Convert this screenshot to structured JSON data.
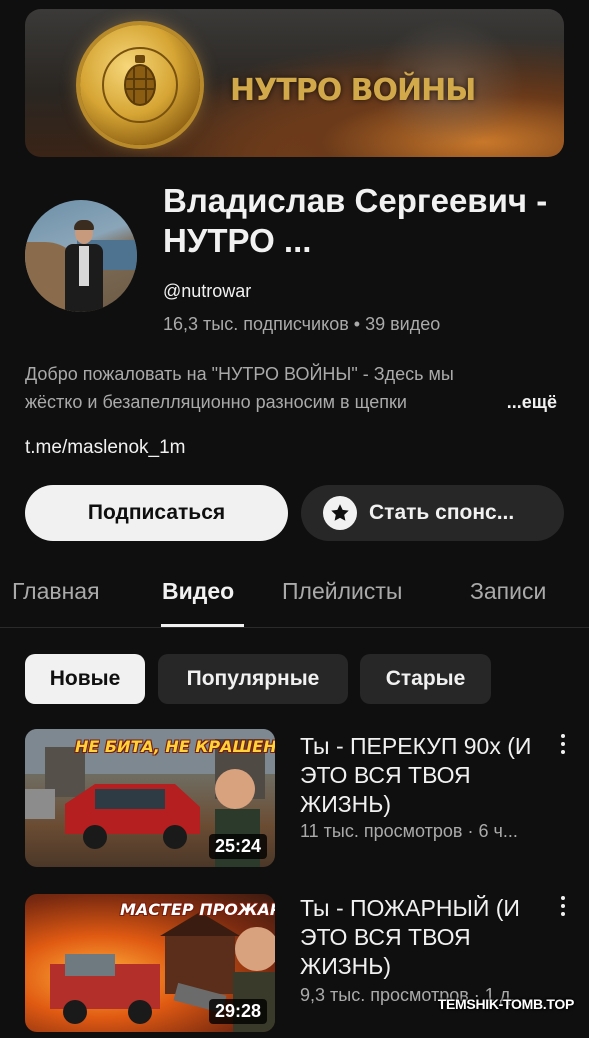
{
  "banner": {
    "title": "НУТРО ВОЙНЫ"
  },
  "channel": {
    "name": "Владислав Сергеевич - НУТРО ...",
    "handle": "@nutrowar",
    "stats": "16,3 тыс. подписчиков • 39 видео",
    "description_line1": "Добро пожаловать на \"НУТРО ВОЙНЫ\" - Здесь мы",
    "description_line2": "жёстко и безапелляционно разносим в щепки",
    "more_label": "...ещё",
    "link": "t.me/maslenok_1m"
  },
  "actions": {
    "subscribe_label": "Подписаться",
    "sponsor_label": "Стать спонс..."
  },
  "tabs": [
    {
      "label": "Главная"
    },
    {
      "label": "Видео"
    },
    {
      "label": "Плейлисты"
    },
    {
      "label": "Записи"
    }
  ],
  "filters": [
    {
      "label": "Новые"
    },
    {
      "label": "Популярные"
    },
    {
      "label": "Старые"
    }
  ],
  "videos": [
    {
      "thumb_text": "НЕ БИТА, НЕ КРАШЕНА",
      "duration": "25:24",
      "title": "Ты - ПЕРЕКУП 90х (И ЭТО ВСЯ ТВОЯ ЖИЗНЬ)",
      "meta": "11 тыс. просмотров · 6 ч..."
    },
    {
      "thumb_text": "МАСТЕР ПРОЖАРКИ",
      "duration": "29:28",
      "title": "Ты - ПОЖАРНЫЙ (И ЭТО ВСЯ ТВОЯ ЖИЗНЬ)",
      "meta": "9,3 тыс. просмотров · 1 д..."
    }
  ],
  "watermark": "TEMSHIK-TOMB.TOP"
}
